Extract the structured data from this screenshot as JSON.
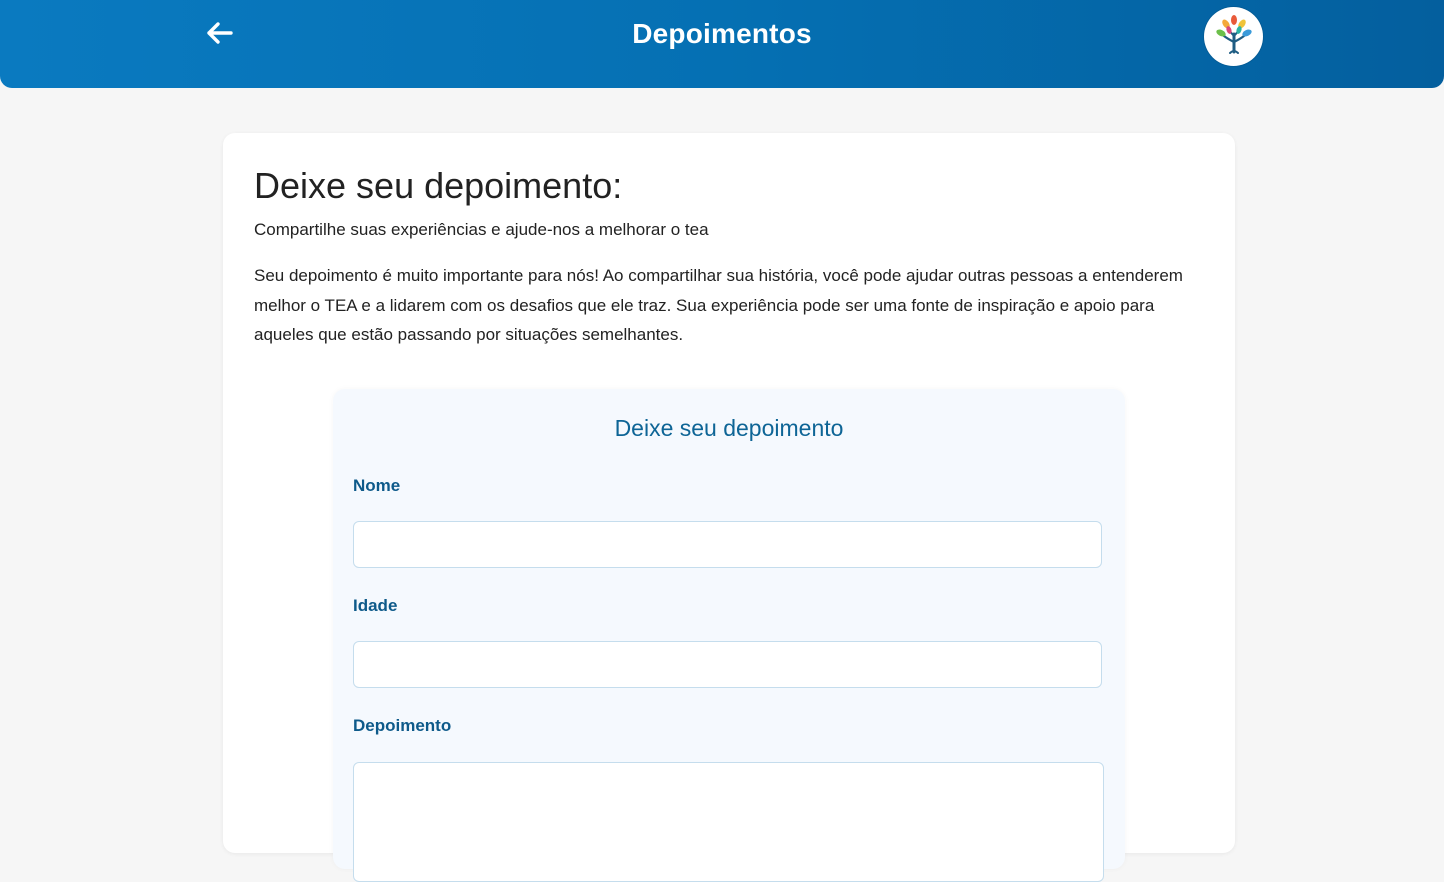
{
  "header": {
    "title": "Depoimentos",
    "back_icon": "arrow-left-icon",
    "logo_icon": "tree-logo-icon"
  },
  "card": {
    "title": "Deixe seu depoimento:",
    "subtitle": "Compartilhe suas experiências e ajude-nos a melhorar o tea",
    "description": "Seu depoimento é muito importante para nós! Ao compartilhar sua história, você pode ajudar outras pessoas a entenderem melhor o TEA e a lidarem com os desafios que ele traz. Sua experiência pode ser uma fonte de inspiração e apoio para aqueles que estão passando por situações semelhantes."
  },
  "form": {
    "title": "Deixe seu depoimento",
    "name_label": "Nome",
    "name_value": "",
    "age_label": "Idade",
    "age_value": "",
    "testimony_label": "Depoimento",
    "testimony_value": ""
  },
  "colors": {
    "header_start": "#0a7ac0",
    "header_end": "#045f9e",
    "label_blue": "#0e5a8a",
    "form_title_blue": "#0e6596",
    "form_background": "#f5f9fe",
    "page_background": "#f6f6f6"
  }
}
